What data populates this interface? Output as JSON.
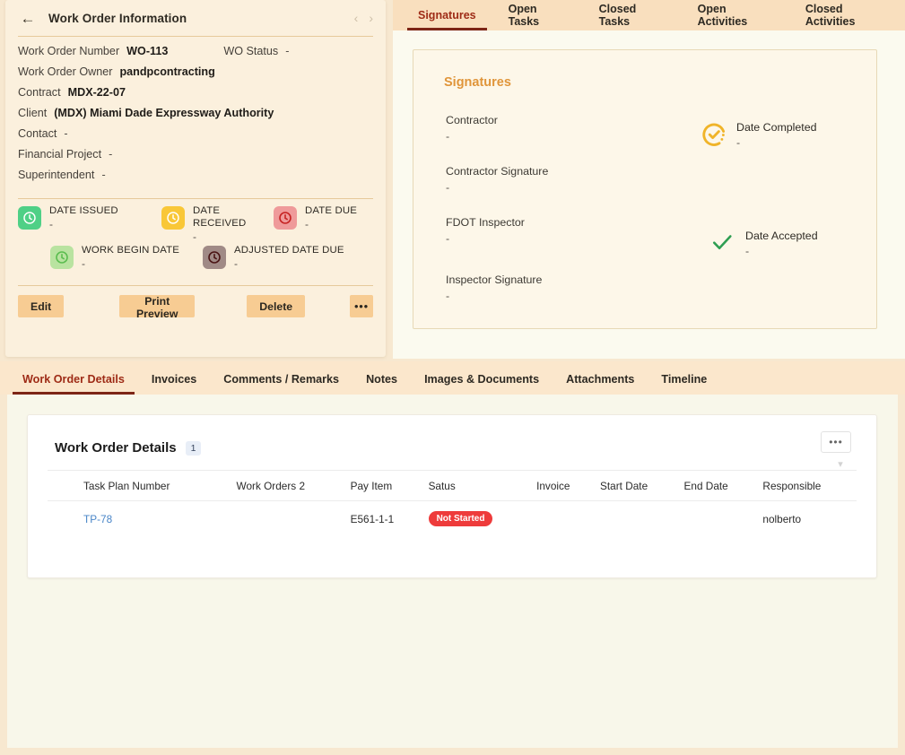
{
  "work_order": {
    "header_title": "Work Order Information",
    "back_icon": "arrow-left-icon",
    "prev_icon": "chevron-left-icon",
    "next_icon": "chevron-right-icon",
    "fields": [
      {
        "label": "Work Order Number",
        "value": "WO-113",
        "label2": "WO Status",
        "value2": "-"
      },
      {
        "label": "Work Order Owner",
        "value": "pandpcontracting"
      },
      {
        "label": "Contract",
        "value": "MDX-22-07"
      },
      {
        "label": "Client",
        "value": "(MDX) Miami Dade Expressway Authority"
      },
      {
        "label": "Contact",
        "value": "-"
      },
      {
        "label": "Financial Project",
        "value": "-"
      },
      {
        "label": "Superintendent",
        "value": "-"
      }
    ],
    "dates": [
      {
        "label": "DATE ISSUED",
        "value": "-",
        "icon": "clock-icon",
        "tile_color": "#4fd086",
        "glyph_color": "#ffffff"
      },
      {
        "label": "DATE RECEIVED",
        "value": "-",
        "icon": "clock-icon",
        "tile_color": "#f9c737",
        "glyph_color": "#ffffff"
      },
      {
        "label": "DATE DUE",
        "value": "-",
        "icon": "clock-icon",
        "tile_color": "#ef9a9a",
        "glyph_color": "#c62222"
      },
      {
        "label": "WORK BEGIN DATE",
        "value": "-",
        "icon": "clock-icon",
        "tile_color": "#b9e3a0",
        "glyph_color": "#5bbd4f"
      },
      {
        "label": "ADJUSTED DATE DUE",
        "value": "-",
        "icon": "clock-icon",
        "tile_color": "#a08a86",
        "glyph_color": "#4a1414"
      }
    ],
    "buttons": [
      {
        "label": "Edit"
      },
      {
        "label": "Print Preview"
      },
      {
        "label": "Delete"
      },
      {
        "label": "•••"
      }
    ]
  },
  "top_tabs": [
    {
      "label": "Signatures",
      "active": true
    },
    {
      "label": "Open Tasks",
      "active": false
    },
    {
      "label": "Closed Tasks",
      "active": false
    },
    {
      "label": "Open Activities",
      "active": false
    },
    {
      "label": "Closed Activities",
      "active": false
    }
  ],
  "signatures": {
    "title": "Signatures",
    "fields": [
      {
        "label": "Contractor",
        "value": "-"
      },
      {
        "label": "Contractor Signature",
        "value": "-"
      },
      {
        "label": "FDOT Inspector",
        "value": "-"
      },
      {
        "label": "Inspector Signature",
        "value": "-"
      }
    ],
    "statuses": [
      {
        "label": "Date Completed",
        "value": "-",
        "icon": "check-circle-dotted-icon",
        "color": "#f0b429"
      },
      {
        "label": "Date Accepted",
        "value": "-",
        "icon": "check-icon",
        "color": "#2e9e52"
      }
    ]
  },
  "bottom_tabs": [
    {
      "label": "Work Order Details",
      "active": true
    },
    {
      "label": "Invoices",
      "active": false
    },
    {
      "label": "Comments / Remarks",
      "active": false
    },
    {
      "label": "Notes",
      "active": false
    },
    {
      "label": "Images & Documents",
      "active": false
    },
    {
      "label": "Attachments",
      "active": false
    },
    {
      "label": "Timeline",
      "active": false
    }
  ],
  "details": {
    "title": "Work Order Details",
    "count": "1",
    "more_label": "•••",
    "expand_icon": "chevron-down-icon",
    "columns": [
      "Task Plan Number",
      "Work Orders 2",
      "Pay Item",
      "Satus",
      "Invoice",
      "Start Date",
      "End Date",
      "Responsible"
    ],
    "rows": [
      {
        "task_plan_number": "TP-78",
        "work_orders_2": "",
        "pay_item": "E561-1-1",
        "status": "Not Started",
        "invoice": "",
        "start_date": "",
        "end_date": "",
        "responsible": "nolberto"
      }
    ]
  },
  "colors": {
    "page_bg": "#f7e8d0",
    "card_bg": "#fbf0dd",
    "accent_tab": "#9e2b16",
    "button_bg": "#f7cc93",
    "signature_title": "#e0953a",
    "status_pill": "#ee3b3b",
    "link": "#4a86c8"
  }
}
